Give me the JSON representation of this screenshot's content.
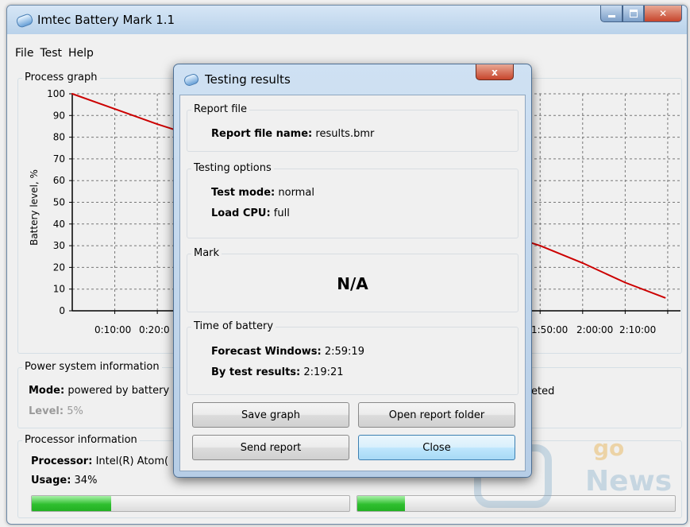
{
  "window": {
    "title": "Imtec Battery Mark 1.1"
  },
  "menu": [
    "File",
    "Test",
    "Help"
  ],
  "graph": {
    "group_label": "Process graph",
    "ylabel": "Battery level, %",
    "y_ticks": [
      "100",
      "90",
      "80",
      "70",
      "60",
      "50",
      "40",
      "30",
      "20",
      "10",
      "0"
    ],
    "x_ticks_left": [
      "0:10:00",
      "0:20:0"
    ],
    "x_ticks_right": [
      "1:50:00",
      "2:00:00",
      "2:10:00"
    ],
    "line_color": "#cc0000",
    "chart_data": {
      "type": "line",
      "x": [
        "0:00:00",
        "0:10:00",
        "0:20:00",
        "1:50:00",
        "2:00:00",
        "2:10:00",
        "2:19:21"
      ],
      "y": [
        100,
        93,
        86,
        30,
        22,
        13,
        6
      ],
      "ylim": [
        0,
        100
      ],
      "ylabel": "Battery level, %"
    }
  },
  "power": {
    "group_label": "Power system information",
    "mode_key": "Mode:",
    "mode_value": "powered by battery",
    "level_key": "Level:",
    "level_value": "5%",
    "right_fragment": "eted"
  },
  "processor": {
    "group_label": "Processor information",
    "cpu_key": "Processor:",
    "cpu_value": "Intel(R) Atom(",
    "usage_key": "Usage:",
    "usage_value": "34%",
    "bar1_fill": 0.25,
    "bar2_fill": 0.15
  },
  "dialog": {
    "title": "Testing results",
    "close_glyph": "x",
    "report": {
      "label": "Report file",
      "key": "Report file name:",
      "value": "results.bmr"
    },
    "options": {
      "label": "Testing options",
      "mode_key": "Test mode:",
      "mode_value": "normal",
      "cpu_key": "Load CPU:",
      "cpu_value": "full"
    },
    "mark": {
      "label": "Mark",
      "value": "N/A"
    },
    "time": {
      "label": "Time of battery",
      "forecast_key": "Forecast Windows:",
      "forecast_value": "2:59:19",
      "test_key": "By test results:",
      "test_value": "2:19:21"
    },
    "buttons": {
      "save_graph": "Save graph",
      "open_folder": "Open report folder",
      "send_report": "Send report",
      "close": "Close"
    }
  },
  "watermark": {
    "top": "go",
    "brand": "News"
  }
}
